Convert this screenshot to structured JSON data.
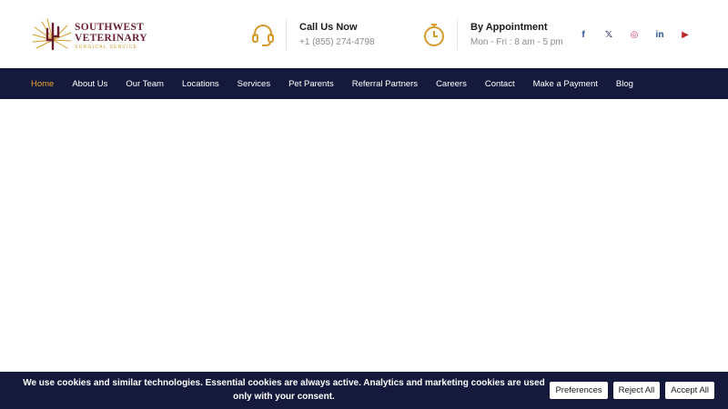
{
  "brand": {
    "line1": "SOUTHWEST",
    "line2": "VETERINARY",
    "line3": "SURGICAL SERVICE"
  },
  "contact": {
    "call": {
      "title": "Call Us Now",
      "value": "+1 (855) 274-4798",
      "icon": "headset-icon"
    },
    "appointment": {
      "title": "By Appointment",
      "value": "Mon - Fri : 8 am - 5 pm",
      "icon": "stopwatch-icon"
    }
  },
  "social": [
    {
      "name": "facebook-icon",
      "glyph": "f"
    },
    {
      "name": "x-twitter-icon",
      "glyph": "𝕏"
    },
    {
      "name": "instagram-icon",
      "glyph": "◎"
    },
    {
      "name": "linkedin-icon",
      "glyph": "in"
    },
    {
      "name": "youtube-icon",
      "glyph": "▶"
    }
  ],
  "nav": {
    "items": [
      {
        "label": "Home",
        "active": true
      },
      {
        "label": "About Us"
      },
      {
        "label": "Our Team"
      },
      {
        "label": "Locations"
      },
      {
        "label": "Services"
      },
      {
        "label": "Pet Parents"
      },
      {
        "label": "Referral Partners"
      },
      {
        "label": "Careers"
      },
      {
        "label": "Contact"
      },
      {
        "label": "Make a Payment"
      },
      {
        "label": "Blog"
      }
    ]
  },
  "cookie": {
    "text": "We use cookies and similar technologies. Essential cookies are always active. Analytics and marketing cookies are used only with your consent.",
    "preferences": "Preferences",
    "reject": "Reject All",
    "accept": "Accept All"
  },
  "colors": {
    "navy": "#151a3c",
    "gold": "#e8a531",
    "maroon": "#6b1f2e"
  }
}
